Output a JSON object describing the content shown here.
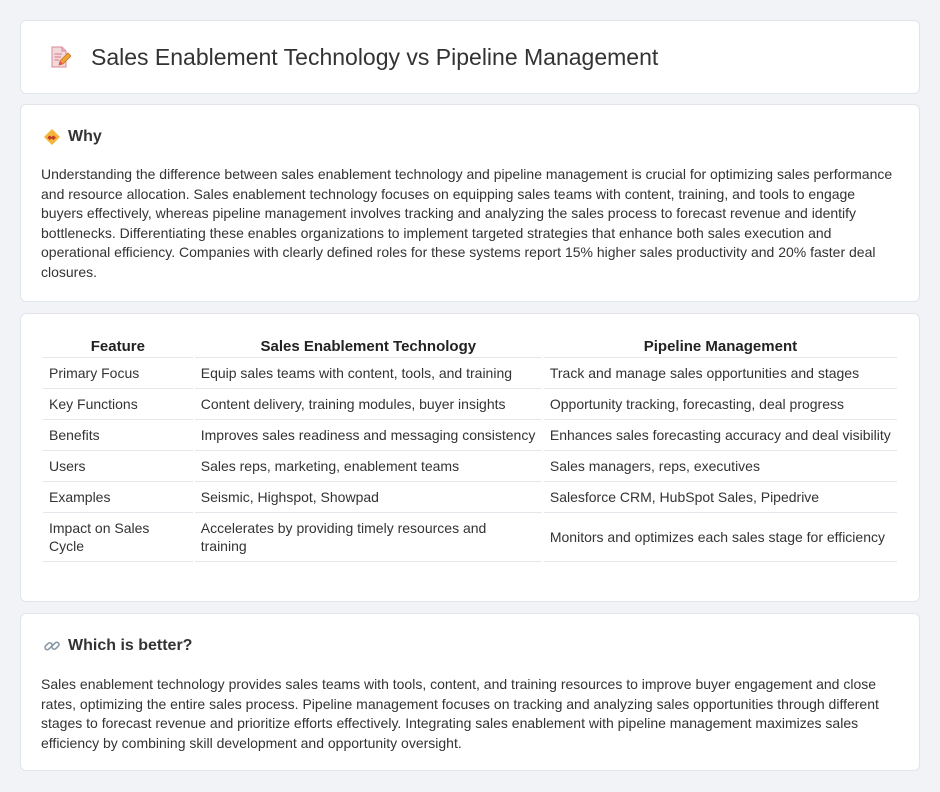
{
  "header": {
    "title": "Sales Enablement Technology vs Pipeline Management",
    "icon": "document-pencil-icon"
  },
  "why": {
    "title": "Why",
    "icon": "handshake-icon",
    "text": "Understanding the difference between sales enablement technology and pipeline management is crucial for optimizing sales performance and resource allocation. Sales enablement technology focuses on equipping sales teams with content, training, and tools to engage buyers effectively, whereas pipeline management involves tracking and analyzing the sales process to forecast revenue and identify bottlenecks. Differentiating these enables organizations to implement targeted strategies that enhance both sales execution and operational efficiency. Companies with clearly defined roles for these systems report 15% higher sales productivity and 20% faster deal closures."
  },
  "table": {
    "headers": [
      "Feature",
      "Sales Enablement Technology",
      "Pipeline Management"
    ],
    "rows": [
      [
        "Primary Focus",
        "Equip sales teams with content, tools, and training",
        "Track and manage sales opportunities and stages"
      ],
      [
        "Key Functions",
        "Content delivery, training modules, buyer insights",
        "Opportunity tracking, forecasting, deal progress"
      ],
      [
        "Benefits",
        "Improves sales readiness and messaging consistency",
        "Enhances sales forecasting accuracy and deal visibility"
      ],
      [
        "Users",
        "Sales reps, marketing, enablement teams",
        "Sales managers, reps, executives"
      ],
      [
        "Examples",
        "Seismic, Highspot, Showpad",
        "Salesforce CRM, HubSpot Sales, Pipedrive"
      ],
      [
        "Impact on Sales Cycle",
        "Accelerates by providing timely resources and training",
        "Monitors and optimizes each sales stage for efficiency"
      ]
    ]
  },
  "better": {
    "title": "Which is better?",
    "icon": "link-icon",
    "text": "Sales enablement technology provides sales teams with tools, content, and training resources to improve buyer engagement and close rates, optimizing the entire sales process. Pipeline management focuses on tracking and analyzing sales opportunities through different stages to forecast revenue and prioritize efforts effectively. Integrating sales enablement with pipeline management maximizes sales efficiency by combining skill development and opportunity oversight."
  }
}
